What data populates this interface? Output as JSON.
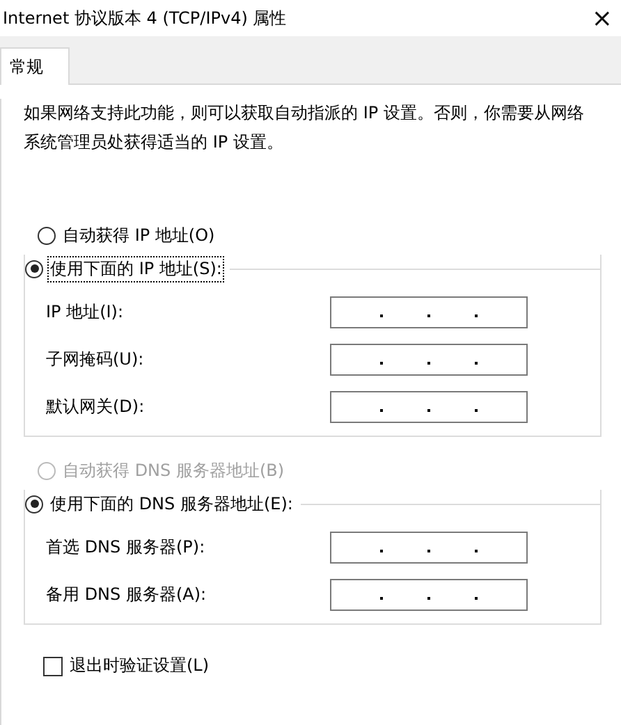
{
  "window": {
    "title": "Internet 协议版本 4 (TCP/IPv4) 属性",
    "close": "×"
  },
  "tabs": [
    {
      "label": "常规",
      "selected": true
    }
  ],
  "description": "如果网络支持此功能，则可以获取自动指派的 IP 设置。否则，你需要从网络系统管理员处获得适当的 IP 设置。",
  "ip_section": {
    "auto_option": {
      "label": "自动获得 IP 地址(O)",
      "selected": false,
      "disabled": false,
      "focused": false
    },
    "manual_option": {
      "label": "使用下面的 IP 地址(S):",
      "selected": true,
      "disabled": false,
      "focused": true
    },
    "fields": [
      {
        "label": "IP 地址(I):"
      },
      {
        "label": "子网掩码(U):"
      },
      {
        "label": "默认网关(D):"
      }
    ]
  },
  "dns_section": {
    "auto_option": {
      "label": "自动获得 DNS 服务器地址(B)",
      "selected": false,
      "disabled": true,
      "focused": false
    },
    "manual_option": {
      "label": "使用下面的 DNS 服务器地址(E):",
      "selected": true,
      "disabled": false,
      "focused": false
    },
    "fields": [
      {
        "label": "首选 DNS 服务器(P):"
      },
      {
        "label": "备用 DNS 服务器(A):"
      }
    ]
  },
  "validate_on_exit": {
    "label": "退出时验证设置(L)",
    "checked": false
  }
}
